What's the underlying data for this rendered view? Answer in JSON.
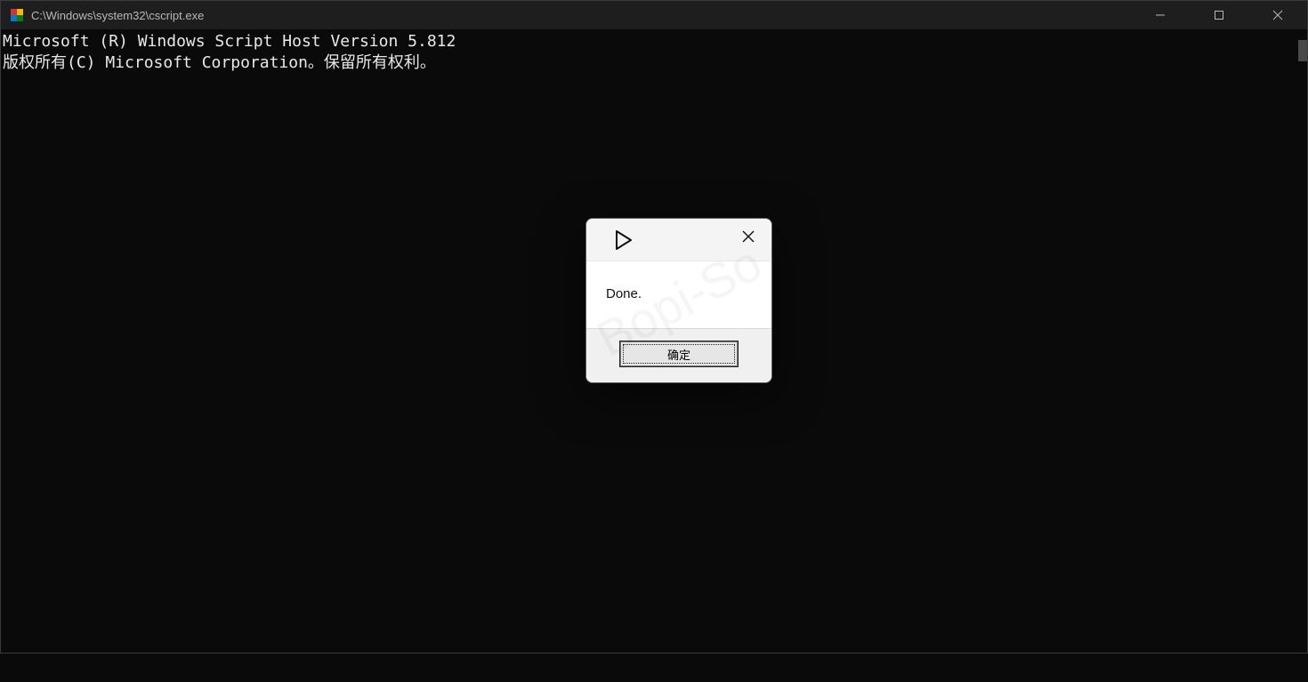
{
  "window": {
    "title": "C:\\Windows\\system32\\cscript.exe"
  },
  "console": {
    "line1": "Microsoft (R) Windows Script Host Version 5.812",
    "line2": "版权所有(C) Microsoft Corporation。保留所有权利。"
  },
  "dialog": {
    "message": "Done.",
    "ok_label": "确定"
  },
  "watermark": "Bopi-So"
}
